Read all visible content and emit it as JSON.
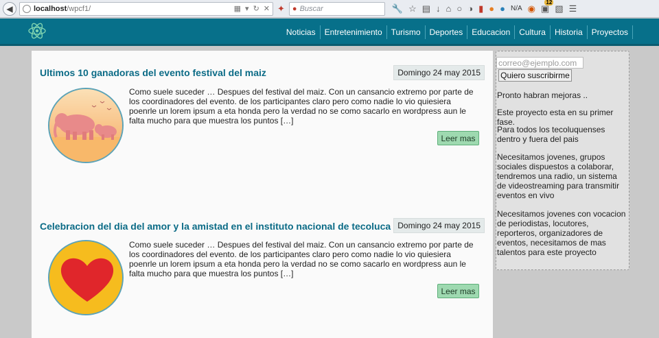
{
  "browser": {
    "url_host": "localhost",
    "url_path": "/wpcf1/",
    "search_placeholder": "Buscar",
    "toolbar_badge": "12",
    "toolbar_na": "N/A"
  },
  "site": {
    "accent": "#07708a",
    "nav": [
      "Noticias",
      "Entretenimiento",
      "Turismo",
      "Deportes",
      "Educacion",
      "Cultura",
      "Historia",
      "Proyectos"
    ]
  },
  "posts": [
    {
      "title": "Ultimos 10 ganadoras del evento festival del maiz",
      "date": "Domingo 24 may 2015",
      "excerpt": "Como suele suceder … Despues del festival del maiz. Con un cansancio extremo por parte de los coordinadores del evento. de los participantes claro pero como nadie lo vio quiesiera poenrle un lorem ipsum a eta honda pero la verdad no se como sacarlo en wordpress aun le falta mucho para que muestra los puntos […]",
      "read_more": "Leer mas",
      "image": "elephants-illustration"
    },
    {
      "title": "Celebracion del dia del amor y la amistad en el instituto nacional de tecoluca",
      "date": "Domingo 24 may 2015",
      "excerpt": "Como suele suceder … Despues del festival del maiz. Con un cansancio extremo por parte de los coordinadores del evento. de los participantes claro pero como nadie lo vio quiesiera poenrle un lorem ipsum a eta honda pero la verdad no se como sacarlo en wordpress aun le falta mucho para que muestra los puntos […]",
      "read_more": "Leer mas",
      "image": "heart-illustration"
    }
  ],
  "sidebar": {
    "email_placeholder": "correo@ejemplo.com",
    "subscribe_label": "Quiero suscribirme",
    "paragraphs": [
      "Pronto habran mejoras ..",
      "Este proyecto esta en su primer fase.",
      "Para todos los tecoluquenses dentro y fuera del pais",
      "Necesitamos jovenes, grupos sociales dispuestos a colaborar, tendremos una radio, un sistema de videostreaming para transmitir eventos en vivo",
      "Necesitamos jovenes con vocacion de periodistas, locutores, reporteros, organizadores de eventos, necesitamos de mas talentos para este proyecto"
    ]
  }
}
